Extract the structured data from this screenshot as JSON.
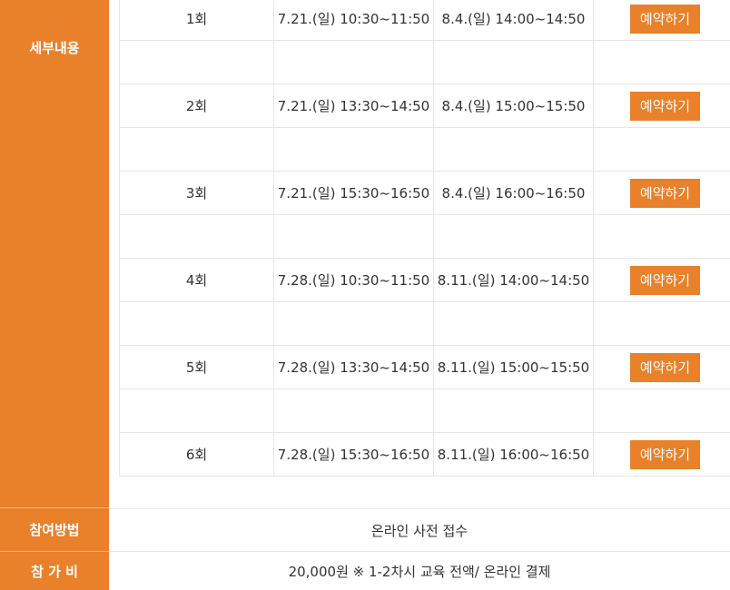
{
  "labels": {
    "detail": "세부내용",
    "method": "참여방법",
    "fee": "참 가 비"
  },
  "schedule": [
    {
      "session": "1회",
      "first": "7.21.(일) 10:30~11:50",
      "second": "8.4.(일) 14:00~14:50",
      "button": "예약하기"
    },
    {
      "session": "2회",
      "first": "7.21.(일) 13:30~14:50",
      "second": "8.4.(일) 15:00~15:50",
      "button": "예약하기"
    },
    {
      "session": "3회",
      "first": "7.21.(일) 15:30~16:50",
      "second": "8.4.(일) 16:00~16:50",
      "button": "예약하기"
    },
    {
      "session": "4회",
      "first": "7.28.(일) 10:30~11:50",
      "second": "8.11.(일) 14:00~14:50",
      "button": "예약하기"
    },
    {
      "session": "5회",
      "first": "7.28.(일) 13:30~14:50",
      "second": "8.11.(일) 15:00~15:50",
      "button": "예약하기"
    },
    {
      "session": "6회",
      "first": "7.28.(일) 15:30~16:50",
      "second": "8.11.(일) 16:00~16:50",
      "button": "예약하기"
    }
  ],
  "method": "온라인 사전 접수",
  "fee": "20,000원 ※ 1-2차시 교육 전액/ 온라인 결제",
  "colors": {
    "accent": "#e8812a",
    "border": "#e6e6e6",
    "text": "#333333"
  }
}
